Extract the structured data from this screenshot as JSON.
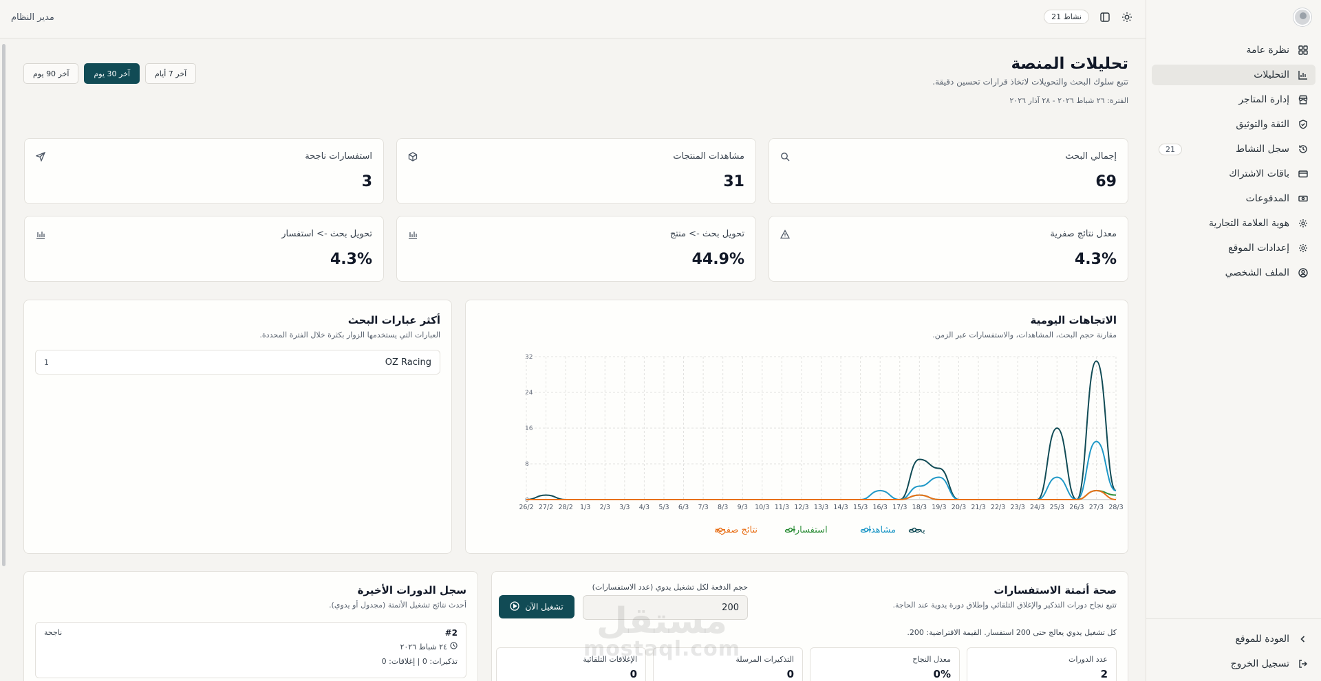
{
  "sidebar": {
    "items": [
      {
        "label": "نظرة عامة",
        "icon": "grid-icon"
      },
      {
        "label": "التحليلات",
        "icon": "bar-chart-icon"
      },
      {
        "label": "إدارة المتاجر",
        "icon": "store-icon"
      },
      {
        "label": "الثقة والتوثيق",
        "icon": "shield-check-icon"
      },
      {
        "label": "سجل النشاط",
        "icon": "history-icon",
        "count": "21"
      },
      {
        "label": "باقات الاشتراك",
        "icon": "credit-card-icon"
      },
      {
        "label": "المدفوعات",
        "icon": "banknote-icon"
      },
      {
        "label": "هوية العلامة التجارية",
        "icon": "gear-icon"
      },
      {
        "label": "إعدادات الموقع",
        "icon": "gear-icon"
      },
      {
        "label": "الملف الشخصي",
        "icon": "user-circle-icon"
      }
    ],
    "back_label": "العودة للموقع",
    "logout_label": "تسجيل الخروج"
  },
  "topbar": {
    "role": "مدير النظام",
    "activity_badge": "نشاط 21"
  },
  "header": {
    "title": "تحليلات المنصة",
    "subtitle": "تتبع سلوك البحث والتحويلات لاتخاذ قرارات تحسين دقيقة.",
    "period": "الفترة: ٢٦ شباط ٢٠٢٦ - ٢٨ آذار ٢٠٢٦",
    "ranges": [
      "آخر 7 أيام",
      "آخر 30 يوم",
      "آخر 90 يوم"
    ],
    "selected_range": "آخر 30 يوم"
  },
  "kpis": [
    {
      "label": "إجمالي البحث",
      "value": "69",
      "icon": "search-icon"
    },
    {
      "label": "مشاهدات المنتجات",
      "value": "31",
      "icon": "box-icon"
    },
    {
      "label": "استفسارات ناجحة",
      "value": "3",
      "icon": "send-icon"
    },
    {
      "label": "معدل نتائج صفرية",
      "value": "4.3%",
      "icon": "warning-icon"
    },
    {
      "label": "تحويل بحث -> منتج",
      "value": "44.9%",
      "icon": "bars-icon"
    },
    {
      "label": "تحويل بحث -> استفسار",
      "value": "4.3%",
      "icon": "bars-icon"
    }
  ],
  "trends": {
    "title": "الاتجاهات اليومية",
    "subtitle": "مقارنة حجم البحث، المشاهدات، والاستفسارات عبر الزمن."
  },
  "chart_data": {
    "type": "line",
    "x": [
      "26/2",
      "27/2",
      "28/2",
      "1/3",
      "2/3",
      "3/3",
      "4/3",
      "5/3",
      "6/3",
      "7/3",
      "8/3",
      "9/3",
      "10/3",
      "11/3",
      "12/3",
      "13/3",
      "14/3",
      "15/3",
      "16/3",
      "17/3",
      "18/3",
      "19/3",
      "20/3",
      "21/3",
      "22/3",
      "23/3",
      "24/3",
      "25/3",
      "26/3",
      "27/3",
      "28/3"
    ],
    "series": [
      {
        "name": "بحث",
        "color": "#114b55",
        "values": [
          0,
          1,
          0,
          0,
          0,
          0,
          0,
          0,
          0,
          0,
          0,
          0,
          0,
          0,
          0,
          0,
          0,
          0,
          0,
          0,
          9,
          7,
          0,
          0,
          0,
          0,
          0,
          16,
          0,
          31,
          2
        ]
      },
      {
        "name": "مشاهدات",
        "color": "#1f98c7",
        "values": [
          0,
          0,
          0,
          0,
          0,
          0,
          0,
          0,
          0,
          0,
          0,
          0,
          0,
          0,
          0,
          0,
          0,
          0,
          2,
          0,
          3,
          5,
          0,
          0,
          0,
          0,
          0,
          5,
          0,
          13,
          2
        ]
      },
      {
        "name": "استفسارات",
        "color": "#2f8f3a",
        "values": [
          0,
          0,
          0,
          0,
          0,
          0,
          0,
          0,
          0,
          0,
          0,
          0,
          0,
          0,
          0,
          0,
          0,
          0,
          0,
          0,
          1,
          0,
          0,
          0,
          0,
          0,
          0,
          0,
          0,
          2,
          1
        ]
      },
      {
        "name": "نتائج صفرية",
        "color": "#e8711a",
        "values": [
          0,
          0,
          0,
          0,
          0,
          0,
          0,
          0,
          0,
          0,
          0,
          0,
          0,
          0,
          0,
          0,
          0,
          0,
          0,
          0,
          1,
          0,
          0,
          0,
          0,
          0,
          0,
          0,
          0,
          2,
          0
        ]
      }
    ],
    "y_ticks": [
      "0",
      "8",
      "16",
      "24",
      "32"
    ],
    "ylim": [
      0,
      32
    ],
    "grid": true,
    "legend": "bottom"
  },
  "terms": {
    "title": "أكثر عبارات البحث",
    "subtitle": "العبارات التي يستخدمها الزوار بكثرة خلال الفترة المحددة.",
    "rows": [
      {
        "term": "OZ Racing",
        "count": "1"
      }
    ]
  },
  "health": {
    "title": "صحة أتمتة الاستفسارات",
    "subtitle": "تتبع نجاح دورات التذكير والإغلاق التلقائي وإطلاق دورة يدوية عند الحاجة.",
    "batch_label": "حجم الدفعة لكل تشغيل يدوي (عدد الاستفسارات)",
    "batch_value": "200",
    "run_label": "تشغيل الآن",
    "note": "كل تشغيل يدوي يعالج حتى 200 استفسار. القيمة الافتراضية: 200.",
    "stats": [
      {
        "label": "عدد الدورات",
        "value": "2"
      },
      {
        "label": "معدل النجاح",
        "value": "0%"
      },
      {
        "label": "التذكيرات المرسلة",
        "value": "0"
      },
      {
        "label": "الإغلاقات التلقائية",
        "value": "0"
      }
    ]
  },
  "runs": {
    "title": "سجل الدورات الأخيرة",
    "subtitle": "أحدث نتائج تشغيل الأتمتة (مجدول أو يدوي).",
    "items": [
      {
        "id": "#2",
        "status": "ناجحة",
        "date": "٢٤ شباط ٢٠٢٦",
        "stats": "تذكيرات: 0 | إغلاقات: 0"
      }
    ]
  },
  "watermark": {
    "line1": "مستقل",
    "line2": "mostaql.com"
  }
}
